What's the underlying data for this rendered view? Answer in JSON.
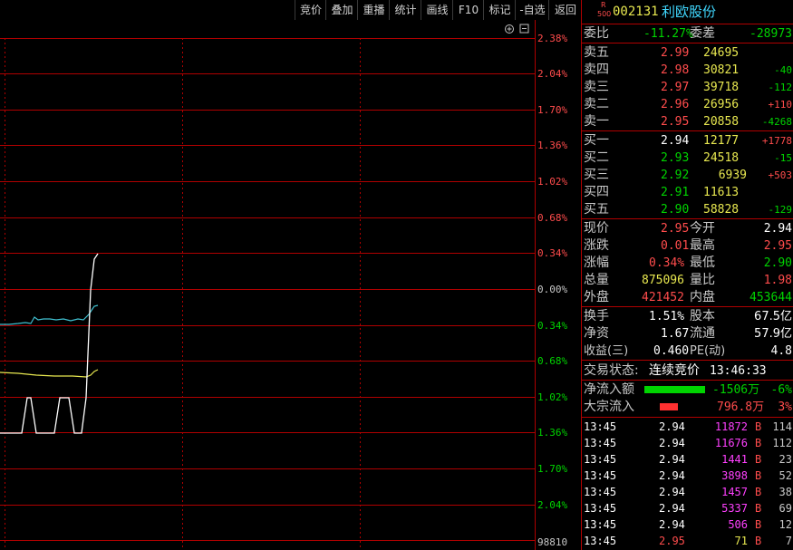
{
  "toolbar": {
    "items": [
      "竞价",
      "叠加",
      "重播",
      "统计",
      "画线",
      "F10",
      "标记",
      "-自选",
      "返回"
    ]
  },
  "chart": {
    "corner_icons": [
      "zoom-in-icon",
      "collapse-icon"
    ],
    "pct_labels_upper": [
      "2.38%",
      "2.04%",
      "1.70%",
      "1.36%",
      "1.02%",
      "0.68%",
      "0.34%"
    ],
    "pct_zero": "0.00%",
    "pct_labels_lower": [
      "0.34%",
      "0.68%",
      "1.02%",
      "1.36%",
      "1.70%",
      "2.04%"
    ],
    "bottom_value": "98810",
    "colors": {
      "grid": "#b00000",
      "price_line": "#ffffff",
      "avg_line": "#e8e850",
      "flow_line": "#40c0d0"
    }
  },
  "stock": {
    "badge_r": "R",
    "badge_500": "500",
    "code": "002131",
    "name": "利欧股份"
  },
  "weibi": {
    "label1": "委比",
    "value1": "-11.27%",
    "label2": "委差",
    "value2": "-28973"
  },
  "sells": [
    {
      "label": "卖五",
      "price": "2.99",
      "vol": "24695",
      "chg": ""
    },
    {
      "label": "卖四",
      "price": "2.98",
      "vol": "30821",
      "chg": "-40"
    },
    {
      "label": "卖三",
      "price": "2.97",
      "vol": "39718",
      "chg": "-112"
    },
    {
      "label": "卖二",
      "price": "2.96",
      "vol": "26956",
      "chg": "+110"
    },
    {
      "label": "卖一",
      "price": "2.95",
      "vol": "20858",
      "chg": "-4268"
    }
  ],
  "buys": [
    {
      "label": "买一",
      "price": "2.94",
      "vol": "12177",
      "chg": "+1778"
    },
    {
      "label": "买二",
      "price": "2.93",
      "vol": "24518",
      "chg": "-15"
    },
    {
      "label": "买三",
      "price": "2.92",
      "vol": "6939",
      "chg": "+503"
    },
    {
      "label": "买四",
      "price": "2.91",
      "vol": "11613",
      "chg": ""
    },
    {
      "label": "买五",
      "price": "2.90",
      "vol": "58828",
      "chg": "-129"
    }
  ],
  "quote": [
    {
      "l1": "现价",
      "v1": "2.95",
      "l2": "今开",
      "v2": "2.94"
    },
    {
      "l1": "涨跌",
      "v1": "0.01",
      "l2": "最高",
      "v2": "2.95"
    },
    {
      "l1": "涨幅",
      "v1": "0.34%",
      "l2": "最低",
      "v2": "2.90"
    },
    {
      "l1": "总量",
      "v1": "875096",
      "l2": "量比",
      "v2": "1.98"
    },
    {
      "l1": "外盘",
      "v1": "421452",
      "l2": "内盘",
      "v2": "453644"
    }
  ],
  "fundamentals": [
    {
      "l1": "换手",
      "v1": "1.51%",
      "l2": "股本",
      "v2": "67.5亿"
    },
    {
      "l1": "净资",
      "v1": "1.67",
      "l2": "流通",
      "v2": "57.9亿"
    },
    {
      "l1": "收益(三)",
      "v1": "0.460",
      "l2": "PE(动)",
      "v2": "4.8"
    }
  ],
  "trade_status": {
    "label": "交易状态:",
    "value": "连续竞价",
    "time": "13:46:33"
  },
  "flows": [
    {
      "label": "净流入额",
      "value": "-1506万",
      "pct": "-6%",
      "bar_color": "#00d400",
      "bar_fraction": 0.72
    },
    {
      "label": "大宗流入",
      "value": "796.8万",
      "pct": "3%",
      "bar_color": "#ff3030",
      "bar_fraction": 0.22
    }
  ],
  "ticks": [
    {
      "time": "13:45",
      "price": "2.94",
      "vol": "11872",
      "side": "B",
      "num": "114"
    },
    {
      "time": "13:45",
      "price": "2.94",
      "vol": "11676",
      "side": "B",
      "num": "112"
    },
    {
      "time": "13:45",
      "price": "2.94",
      "vol": "1441",
      "side": "B",
      "num": "23"
    },
    {
      "time": "13:45",
      "price": "2.94",
      "vol": "3898",
      "side": "B",
      "num": "52"
    },
    {
      "time": "13:45",
      "price": "2.94",
      "vol": "1457",
      "side": "B",
      "num": "38"
    },
    {
      "time": "13:45",
      "price": "2.94",
      "vol": "5337",
      "side": "B",
      "num": "69"
    },
    {
      "time": "13:45",
      "price": "2.94",
      "vol": "506",
      "side": "B",
      "num": "12"
    },
    {
      "time": "13:45",
      "price": "2.95",
      "vol": "71",
      "side": "B",
      "num": "7"
    }
  ]
}
